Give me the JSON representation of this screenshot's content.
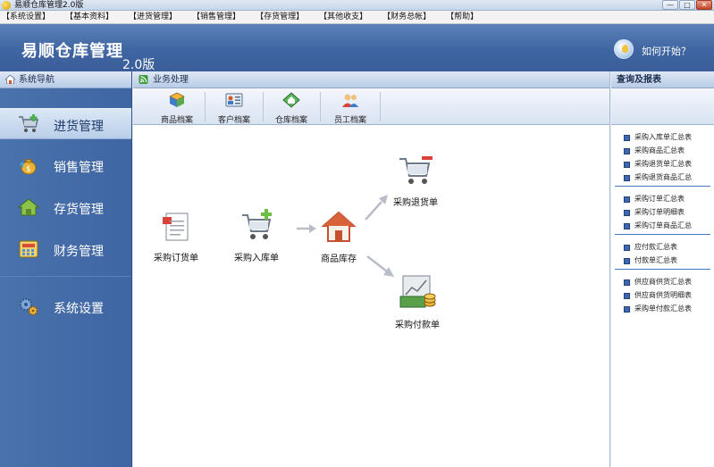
{
  "window": {
    "title": "易顺仓库管理2.0版",
    "minimize": "—",
    "maximize": "□",
    "close": "✕"
  },
  "menu": [
    "【系统设置】",
    "【基本资料】",
    "【进货管理】",
    "【销售管理】",
    "【存货管理】",
    "【其他收支】",
    "【财务总帐】",
    "【帮助】"
  ],
  "header": {
    "brand": "易顺仓库管理",
    "version": "2.0版",
    "help": "如何开始？"
  },
  "leftnav": {
    "title": "系统导航",
    "items": [
      {
        "label": "进货管理",
        "icon": "shopping-cart-icon",
        "active": true
      },
      {
        "label": "销售管理",
        "icon": "money-bag-icon"
      },
      {
        "label": "存货管理",
        "icon": "house-icon"
      },
      {
        "label": "财务管理",
        "icon": "calculator-icon"
      },
      {
        "label": "系统设置",
        "icon": "gears-icon"
      }
    ]
  },
  "center": {
    "title": "业务处理",
    "toolbar": [
      {
        "label": "商品档案",
        "icon": "product-icon"
      },
      {
        "label": "客户档案",
        "icon": "customer-icon"
      },
      {
        "label": "仓库档案",
        "icon": "warehouse-icon"
      },
      {
        "label": "员工档案",
        "icon": "employee-icon"
      }
    ],
    "flow": {
      "order": "采购订货单",
      "inbound": "采购入库单",
      "stock": "商品库存",
      "return": "采购退货单",
      "payment": "采购付款单"
    }
  },
  "right": {
    "title": "查询及报表",
    "groups": [
      [
        "采购入库单汇总表",
        "采购商品汇总表",
        "采购退货单汇总表",
        "采购退货商品汇总"
      ],
      [
        "采购订单汇总表",
        "采购订单明细表",
        "采购订单商品汇总"
      ],
      [
        "应付款汇总表",
        "付款单汇总表"
      ],
      [
        "供应商供货汇总表",
        "供应商供货明细表",
        "采购单付款汇总表"
      ]
    ]
  },
  "colors": {
    "nav_bg": "#4a72ac",
    "header_bg": "#3f65a2",
    "accent": "#3d67b0"
  }
}
